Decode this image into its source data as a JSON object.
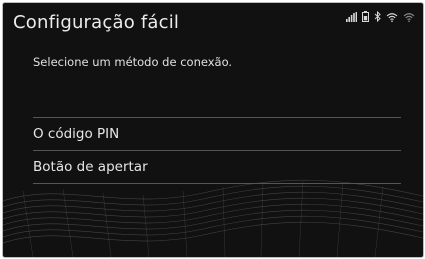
{
  "screen": {
    "title": "Configuração fácil",
    "subtitle": "Selecione um método de conexão."
  },
  "status_bar": {
    "icons": [
      "signal-strength-icon",
      "battery-icon",
      "bluetooth-icon",
      "wifi-icon",
      "wifi-alt-icon"
    ]
  },
  "options": [
    {
      "label": "O código PIN"
    },
    {
      "label": "Botão de apertar"
    }
  ],
  "colors": {
    "background": "#111111",
    "text": "#e6e6e6",
    "divider": "#555555"
  }
}
